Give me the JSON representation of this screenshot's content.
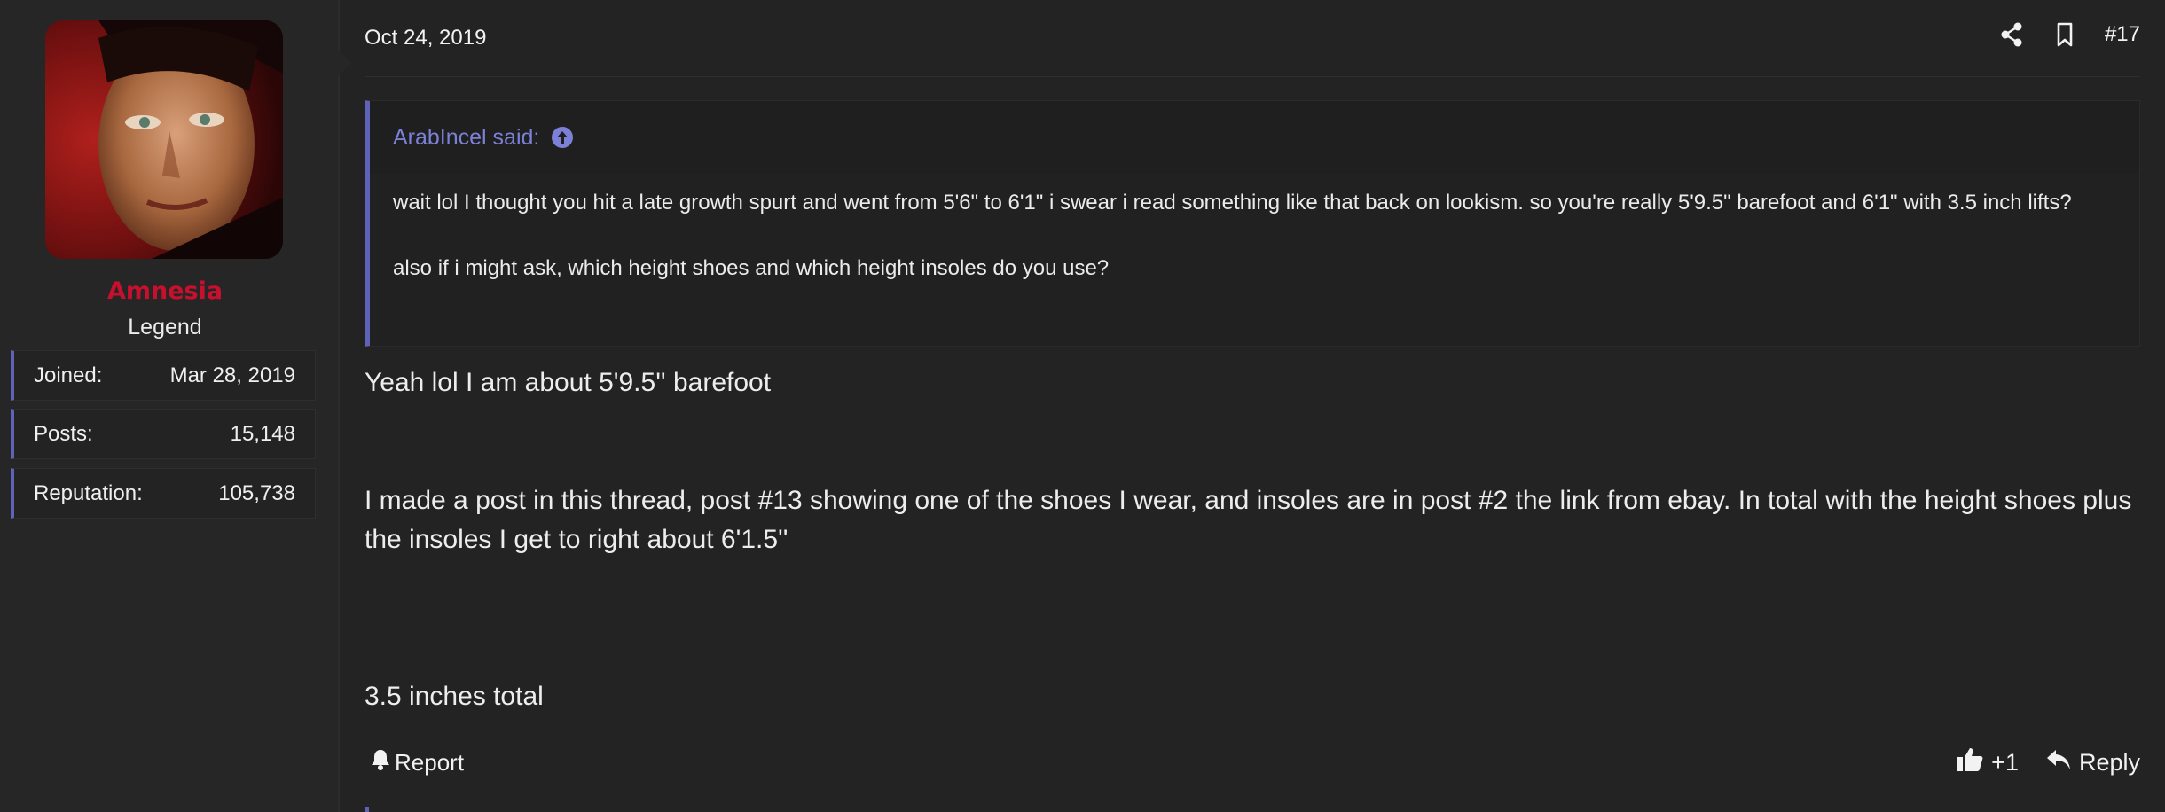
{
  "user": {
    "username": "Amnesia",
    "title": "Legend",
    "stats": [
      {
        "label": "Joined:",
        "value": "Mar 28, 2019"
      },
      {
        "label": "Posts:",
        "value": "15,148"
      },
      {
        "label": "Reputation:",
        "value": "105,738"
      }
    ]
  },
  "post": {
    "date": "Oct 24, 2019",
    "number": "#17",
    "quote": {
      "author_line": "ArabIncel said:",
      "paragraphs": [
        "wait lol I thought you hit a late growth spurt and went from 5'6\" to 6'1\" i swear i read something like that back on lookism. so you're really 5'9.5\" barefoot and 6'1\" with 3.5 inch lifts?",
        "also if i might ask, which height shoes and which height insoles do you use?"
      ]
    },
    "body": [
      "Yeah lol I am about 5'9.5'' barefoot",
      "I made a post in this thread, post #13 showing one of the shoes I wear, and insoles are in post #2 the link from ebay. In total with the height shoes plus the insoles I get to right about 6'1.5''",
      "3.5 inches total"
    ],
    "footer": {
      "report_label": "Report",
      "reaction_count": "+1",
      "reply_label": "Reply"
    }
  },
  "colors": {
    "background": "#232323",
    "sidebar": "#262626",
    "username": "#c8102e",
    "accent": "#5f63b8",
    "quote_title": "#7c80d6"
  },
  "icons": {
    "share": "share-icon",
    "bookmark": "bookmark-icon",
    "quote_jump": "arrow-up-circle-icon",
    "report": "bell-icon",
    "like": "thumbs-up-icon",
    "reply": "reply-arrow-icon"
  }
}
